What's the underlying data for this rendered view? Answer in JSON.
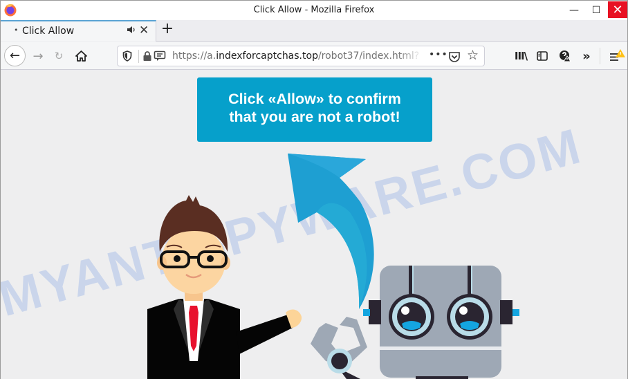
{
  "window": {
    "title": "Click Allow - Mozilla Firefox",
    "minimize_glyph": "—",
    "maximize_glyph": "☐",
    "close_glyph": "✕"
  },
  "tabs": [
    {
      "label": "Click Allow",
      "dot": "•",
      "audio_glyph": "🔈",
      "close_glyph": "✕",
      "active": true
    }
  ],
  "new_tab_glyph": "+",
  "nav": {
    "back_glyph": "←",
    "forward_glyph": "→",
    "reload_glyph": "↻",
    "home_glyph": "⌂"
  },
  "urlbar": {
    "scheme": "https://a.",
    "domain": "indexforcaptchas.top",
    "path": "/robot37/index.html?",
    "more_glyph": "•••",
    "star_glyph": "☆"
  },
  "toolbar": {
    "library_glyph": "III\\",
    "overflow_glyph": "»",
    "menu_glyph": "≡"
  },
  "icons": {
    "firefox": "firefox-logo",
    "shield": "tracking-protection-shield",
    "lock": "lock",
    "permissions": "notification-permission",
    "pocket": "pocket",
    "sidebar": "sidebar",
    "tracking": "tracking-warning",
    "menu_warning": "update-warning"
  },
  "page": {
    "banner_line1": "Click «Allow» to confirm",
    "banner_line2": "that you are not a robot!",
    "watermark": "MYANTISPYWARE.COM"
  },
  "colors": {
    "banner": "#06a0cb",
    "arrow": "#1ea3d4",
    "close_button": "#e81123",
    "robot_body": "#9ea8b5",
    "robot_dark": "#2a2531"
  }
}
